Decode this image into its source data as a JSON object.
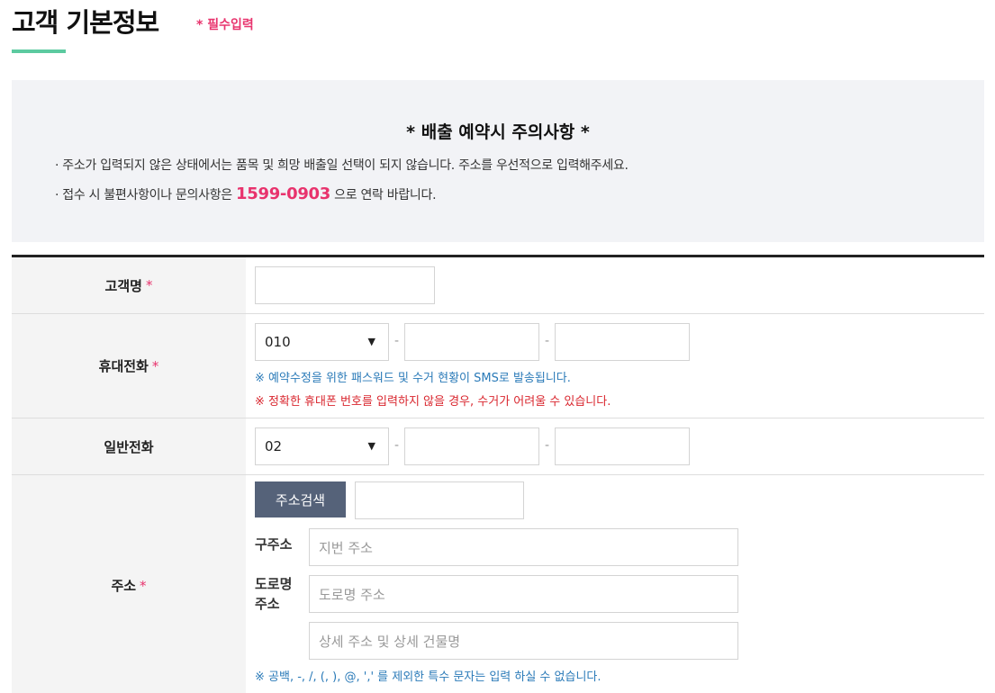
{
  "page": {
    "title": "고객 기본정보",
    "required_note": "* 필수입력"
  },
  "notice": {
    "title": "*  배출 예약시 주의사항  *",
    "line1": "· 주소가 입력되지 않은 상태에서는 품목 및 희망 배출일 선택이 되지 않습니다. 주소를 우선적으로 입력해주세요.",
    "line2_prefix": "· 접수 시 불편사항이나 문의사항은 ",
    "phone": "1599-0903",
    "line2_suffix": " 으로 연락 바랍니다."
  },
  "form": {
    "required_mark": "*",
    "name": {
      "label": "고객명",
      "value": ""
    },
    "mobile": {
      "label": "휴대전화",
      "prefix_selected": "010",
      "dash": "-",
      "info_blue": "※ 예약수정을 위한 패스워드 및 수거 현황이 SMS로 발송됩니다.",
      "info_red": "※ 정확한 휴대폰 번호를 입력하지 않을 경우, 수거가 어려울 수 있습니다."
    },
    "tel": {
      "label": "일반전화",
      "prefix_selected": "02",
      "dash": "-"
    },
    "address": {
      "label": "주소",
      "search_button": "주소검색",
      "old_label": "구주소",
      "old_placeholder": "지번 주소",
      "road_label_line1": "도로명",
      "road_label_line2": "주소",
      "road_placeholder": "도로명 주소",
      "detail_placeholder": "상세 주소 및 상세 건물명",
      "info": "※ 공백, -, /, (, ), @, ',' 를 제외한 특수 문자는 입력 하실 수 없습니다."
    }
  },
  "colors": {
    "accent_pink": "#e8336d",
    "accent_green": "#5ccaa0",
    "button_slate": "#556279",
    "info_blue": "#2a7ab8",
    "info_red": "#d9262e"
  },
  "icons": {
    "select_arrow": "▼"
  }
}
